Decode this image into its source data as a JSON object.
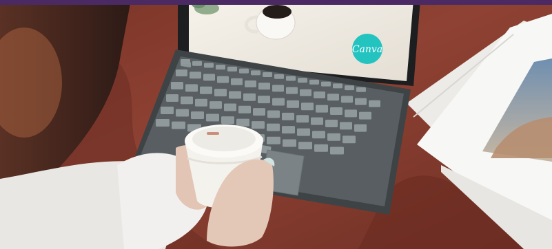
{
  "image": {
    "description_free": true,
    "colors": {
      "top_bar": "#4b2a63",
      "blanket": "#8e3f31",
      "blanket_dark": "#5e2820",
      "laptop_body": "#3f4447",
      "keyboard_felt": "#5b6063",
      "keys": "#8f989a",
      "screen": "#f2efe9",
      "logo_badge": "#23c3c0",
      "cup": "#f3f1ec",
      "sleeve": "#f4f3f1",
      "skin": "#e3c7b6",
      "hair": "#4a2a22",
      "magazine": "#f4f4f2"
    }
  },
  "screen": {
    "logo": {
      "text": "Canva"
    }
  }
}
